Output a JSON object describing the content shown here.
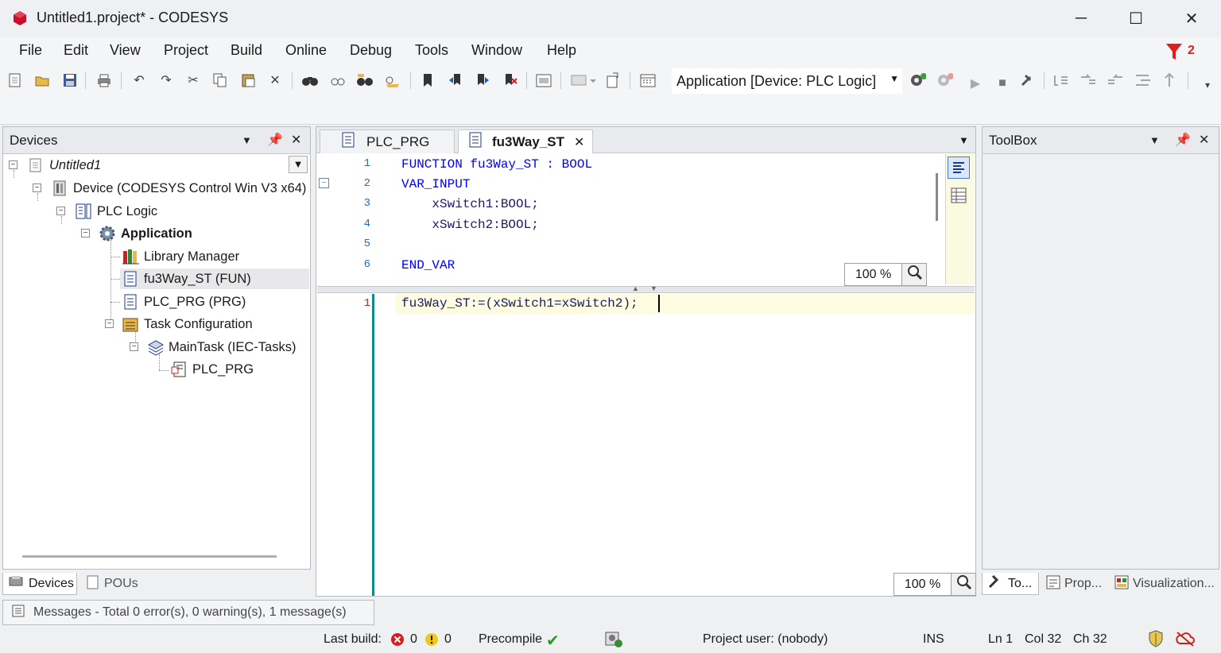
{
  "window": {
    "title": "Untitled1.project* - CODESYS",
    "minimize": "─",
    "maximize": "☐",
    "close": "✕"
  },
  "menu": {
    "items": [
      {
        "label": "File"
      },
      {
        "label": "Edit"
      },
      {
        "label": "View"
      },
      {
        "label": "Project"
      },
      {
        "label": "Build"
      },
      {
        "label": "Online"
      },
      {
        "label": "Debug"
      },
      {
        "label": "Tools"
      },
      {
        "label": "Window"
      },
      {
        "label": "Help"
      }
    ],
    "filter_count": "2"
  },
  "toolbar": {
    "application_selector": "Application [Device: PLC Logic]"
  },
  "devices_panel": {
    "title": "Devices",
    "tree": [
      {
        "label": "Untitled1",
        "icon": "project-icon"
      },
      {
        "label": "Device (CODESYS Control Win V3 x64)",
        "icon": "device-icon"
      },
      {
        "label": "PLC Logic",
        "icon": "plc-logic-icon"
      },
      {
        "label": "Application",
        "icon": "application-gear-icon"
      },
      {
        "label": "Library Manager",
        "icon": "library-icon"
      },
      {
        "label": "fu3Way_ST (FUN)",
        "icon": "pou-icon"
      },
      {
        "label": "PLC_PRG (PRG)",
        "icon": "pou-icon"
      },
      {
        "label": "Task Configuration",
        "icon": "task-config-icon"
      },
      {
        "label": "MainTask (IEC-Tasks)",
        "icon": "task-icon"
      },
      {
        "label": "PLC_PRG",
        "icon": "program-call-icon"
      }
    ],
    "tabs": [
      {
        "label": "Devices"
      },
      {
        "label": "POUs"
      }
    ]
  },
  "messages": {
    "text": "Messages - Total 0 error(s), 0 warning(s), 1 message(s)"
  },
  "editor": {
    "tabs": [
      {
        "label": "PLC_PRG"
      },
      {
        "label": "fu3Way_ST"
      }
    ],
    "decl_lines": [
      {
        "num": "1",
        "text": "FUNCTION fu3Way_ST : BOOL"
      },
      {
        "num": "2",
        "text": "VAR_INPUT"
      },
      {
        "num": "3",
        "text": "    xSwitch1:BOOL;"
      },
      {
        "num": "4",
        "text": "    xSwitch2:BOOL;"
      },
      {
        "num": "5",
        "text": ""
      },
      {
        "num": "6",
        "text": "END_VAR"
      }
    ],
    "impl_lines": [
      {
        "num": "1",
        "text": "fu3Way_ST:=(xSwitch1=xSwitch2);"
      }
    ],
    "decl_zoom": "100 %",
    "impl_zoom": "100 %"
  },
  "toolbox_panel": {
    "title": "ToolBox",
    "tabs": [
      {
        "label": "To..."
      },
      {
        "label": "Prop..."
      },
      {
        "label": "Visualization..."
      }
    ]
  },
  "status": {
    "last_build_label": "Last build:",
    "errors": "0",
    "warnings": "0",
    "precompile": "Precompile",
    "project_user": "Project user: (nobody)",
    "ins": "INS",
    "ln": "Ln 1",
    "col": "Col 32",
    "ch": "Ch 32"
  }
}
